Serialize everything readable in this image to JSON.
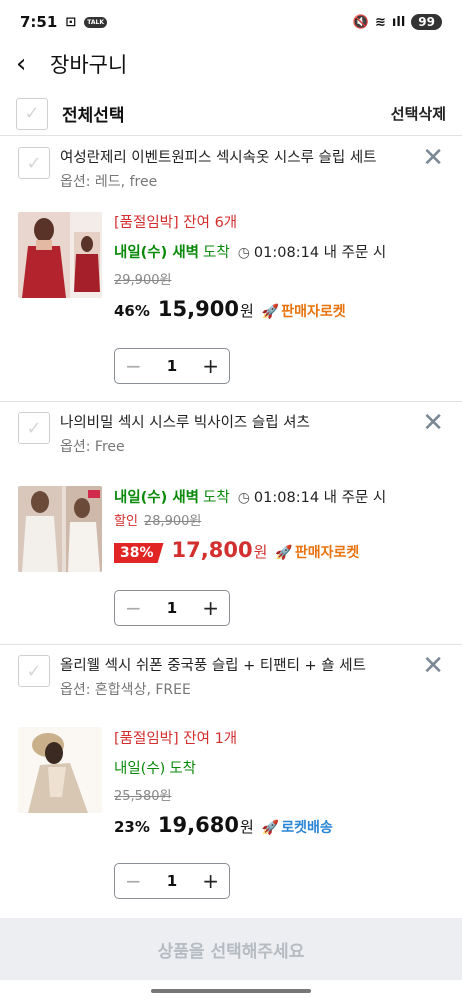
{
  "status_bar": {
    "time": "7:51",
    "talk_badge": "TALK",
    "signal": "ıll",
    "battery": "99"
  },
  "header": {
    "title": "장바구니",
    "back_icon": "chevron-left-icon"
  },
  "select_all": {
    "label": "전체선택",
    "delete_selected": "선택삭제"
  },
  "items": [
    {
      "name": "여성란제리 이벤트원피스 섹시속옷 시스루 슬립 세트",
      "option": "옵션: 레드, free",
      "stock": "[품절임박] 잔여 6개",
      "arrival": "내일(수) 새벽",
      "arrival_suffix": "도착",
      "deadline": "01:08:14 내 주문 시",
      "discount_label": "",
      "original_price": "29,900원",
      "discount_pct": "46%",
      "price": "15,900",
      "won": "원",
      "badge": "판매자로켓",
      "quantity": "1"
    },
    {
      "name": "나의비밀 섹시 시스루 빅사이즈 슬립 셔츠",
      "option": "옵션: Free",
      "stock": "",
      "arrival": "내일(수) 새벽",
      "arrival_suffix": "도착",
      "deadline": "01:08:14 내 주문 시",
      "discount_label": "할인",
      "original_price": "28,900원",
      "discount_pct": "38%",
      "price": "17,800",
      "won": "원",
      "badge": "판매자로켓",
      "quantity": "1"
    },
    {
      "name": "올리웰 섹시 쉬폰 중국풍 슬립 + 티팬티 + 숄 세트",
      "option": "옵션: 혼합색상, FREE",
      "stock": "[품절임박] 잔여 1개",
      "arrival": "내일(수)",
      "arrival_suffix": "도착",
      "deadline": "",
      "discount_label": "",
      "original_price": "25,580원",
      "discount_pct": "23%",
      "price": "19,680",
      "won": "원",
      "badge": "로켓배송",
      "quantity": "1"
    }
  ],
  "bottom": {
    "cta": "상품을 선택해주세요"
  },
  "colors": {
    "accent_red": "#d32f2f",
    "arrival_green": "#0a8a0a",
    "seller_rocket_orange": "#e8720c",
    "rocket_blue": "#2a85d4"
  }
}
